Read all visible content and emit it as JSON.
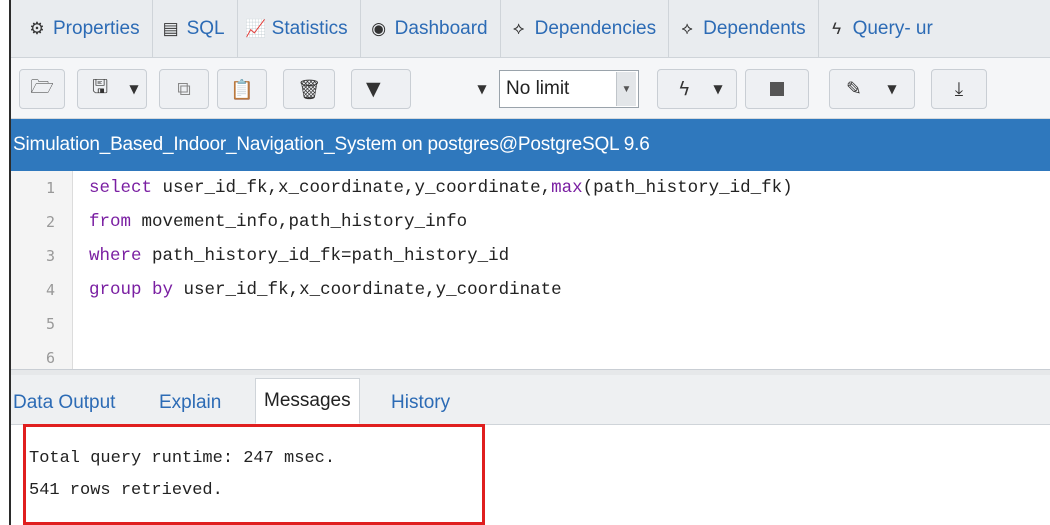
{
  "tabs": [
    {
      "icon": "properties-icon",
      "glyph": "⚙",
      "label": "Properties"
    },
    {
      "icon": "sql-icon",
      "glyph": "▤",
      "label": "SQL"
    },
    {
      "icon": "statistics-icon",
      "glyph": "📈",
      "label": "Statistics"
    },
    {
      "icon": "dashboard-icon",
      "glyph": "◉",
      "label": "Dashboard"
    },
    {
      "icon": "dependencies-icon",
      "glyph": "⟡",
      "label": "Dependencies"
    },
    {
      "icon": "dependents-icon",
      "glyph": "⟡",
      "label": "Dependents"
    },
    {
      "icon": "query-tool-icon",
      "glyph": "ϟ",
      "label": "Query- ur"
    }
  ],
  "toolbar": {
    "limit_value": "No limit"
  },
  "connection": {
    "title": "Simulation_Based_Indoor_Navigation_System on postgres@PostgreSQL 9.6"
  },
  "editor": {
    "line_numbers": [
      "1",
      "2",
      "3",
      "4",
      "5",
      "6"
    ],
    "lines": [
      [
        {
          "t": "select",
          "k": "kw"
        },
        {
          "t": " user_id_fk,x_coordinate,y_coordinate,",
          "k": ""
        },
        {
          "t": "max",
          "k": "fn"
        },
        {
          "t": "(path_history_id_fk)",
          "k": ""
        }
      ],
      [
        {
          "t": "from",
          "k": "kw"
        },
        {
          "t": " movement_info,path_history_info",
          "k": ""
        }
      ],
      [
        {
          "t": "where",
          "k": "kw"
        },
        {
          "t": " path_history_id_fk=path_history_id",
          "k": ""
        }
      ],
      [
        {
          "t": "group",
          "k": "kw"
        },
        {
          "t": " ",
          "k": ""
        },
        {
          "t": "by",
          "k": "kw"
        },
        {
          "t": " user_id_fk,x_coordinate,y_coordinate",
          "k": ""
        }
      ],
      [],
      []
    ]
  },
  "results": {
    "tabs": [
      "Data Output",
      "Explain",
      "Messages",
      "History"
    ],
    "active_tab": "Messages",
    "messages": [
      "Total query runtime: 247 msec.",
      "541 rows retrieved."
    ]
  },
  "colors": {
    "accent": "#2f78bd",
    "keyword": "#7a1fa2",
    "highlight": "#e01f1f"
  }
}
